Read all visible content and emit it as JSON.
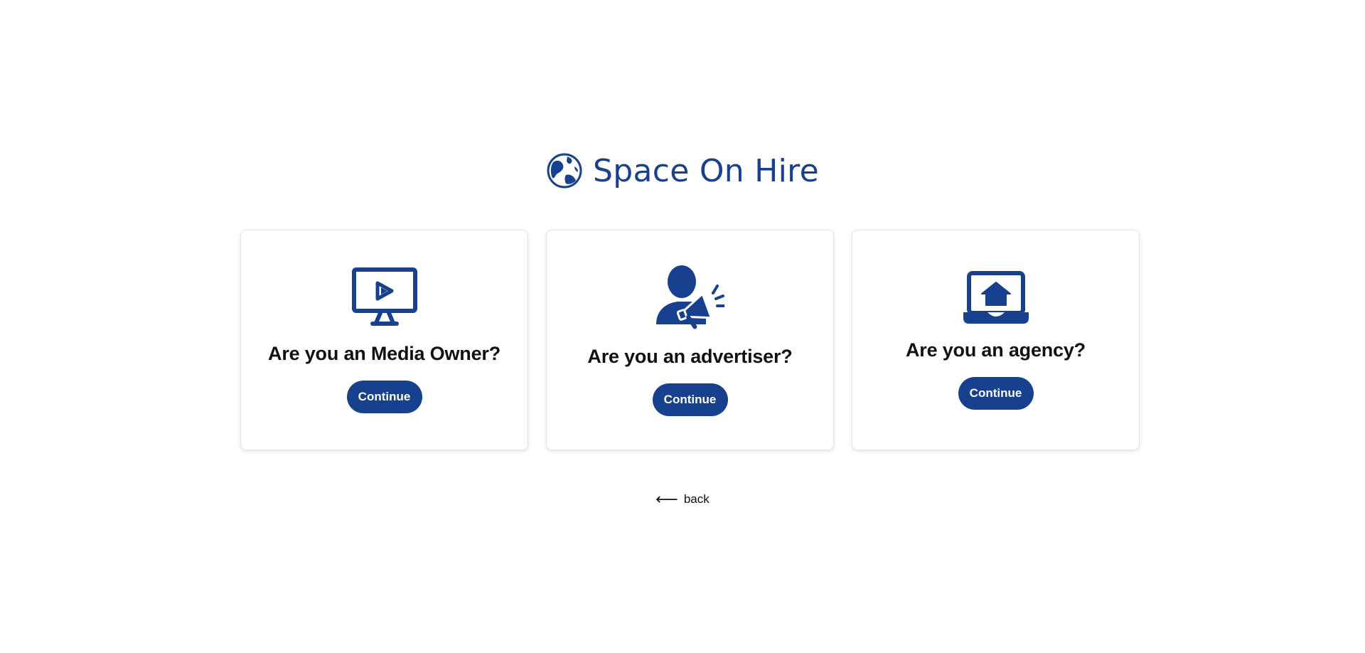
{
  "brand": {
    "name": "Space On Hire",
    "color": "#17408f",
    "icon": "globe-icon"
  },
  "cards": [
    {
      "title": "Are you an Media Owner?",
      "button_label": "Continue",
      "icon": "monitor-play-icon"
    },
    {
      "title": "Are you an advertiser?",
      "button_label": "Continue",
      "icon": "person-megaphone-icon"
    },
    {
      "title": "Are you an agency?",
      "button_label": "Continue",
      "icon": "laptop-home-icon"
    }
  ],
  "back": {
    "label": "back",
    "icon": "arrow-left-icon"
  }
}
